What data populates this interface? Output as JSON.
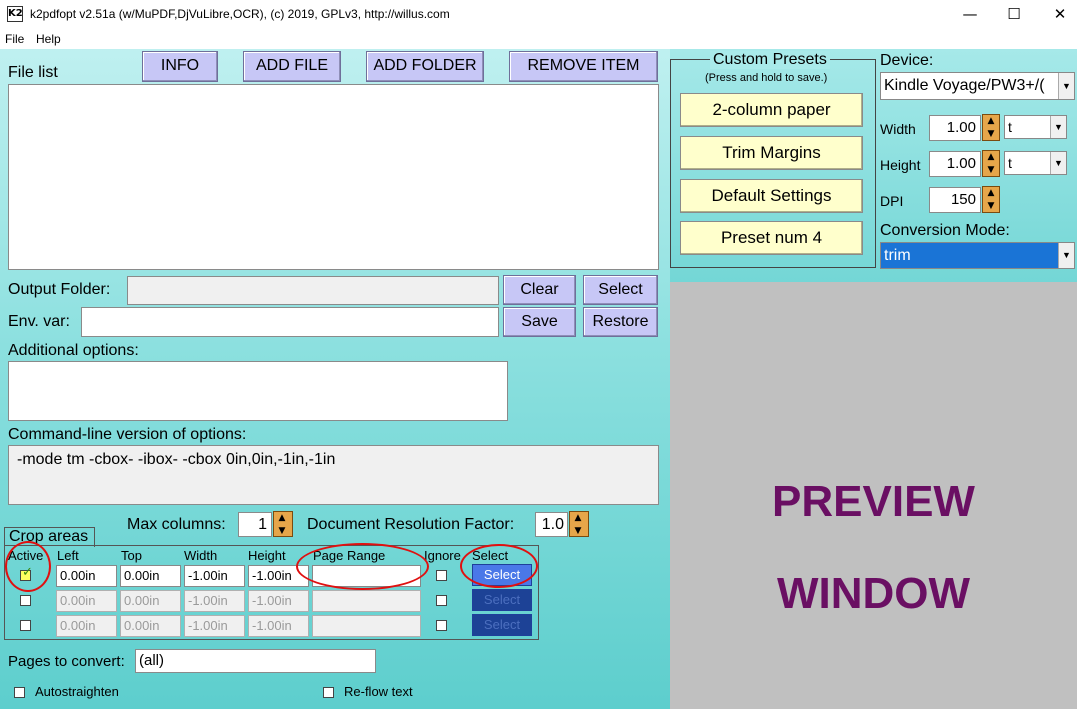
{
  "window": {
    "app_icon": "K2",
    "title": "k2pdfopt v2.51a (w/MuPDF,DjVuLibre,OCR), (c) 2019, GPLv3, http://willus.com",
    "minimize_icon": "—",
    "maximize_icon": "☐",
    "close_icon": "✕"
  },
  "menu": {
    "file": "File",
    "help": "Help"
  },
  "file_list": {
    "label": "File list",
    "info_button": "INFO",
    "add_file_button": "ADD FILE",
    "add_folder_button": "ADD FOLDER",
    "remove_item_button": "REMOVE ITEM"
  },
  "output": {
    "label": "Output Folder:",
    "value": "",
    "clear_button": "Clear",
    "select_button": "Select"
  },
  "env": {
    "label": "Env. var:",
    "value": "",
    "save_button": "Save",
    "restore_button": "Restore"
  },
  "additional": {
    "label": "Additional options:",
    "value": ""
  },
  "cmdline": {
    "label": "Command-line version of options:",
    "value": "-mode tm -cbox- -ibox- -cbox 0in,0in,-1in,-1in"
  },
  "max_columns": {
    "label": "Max columns:",
    "value": "1"
  },
  "doc_res": {
    "label": "Document Resolution Factor:",
    "value": "1.0"
  },
  "crop": {
    "title": "Crop areas",
    "headers": {
      "active": "Active",
      "left": "Left",
      "top": "Top",
      "width": "Width",
      "height": "Height",
      "page_range": "Page Range",
      "ignore": "Ignore",
      "select": "Select"
    },
    "rows": [
      {
        "active_mark": "✓",
        "left": "0.00in",
        "top": "0.00in",
        "width": "-1.00in",
        "height": "-1.00in",
        "page_range": "",
        "select": "Select"
      },
      {
        "active_mark": "",
        "left": "0.00in",
        "top": "0.00in",
        "width": "-1.00in",
        "height": "-1.00in",
        "page_range": "",
        "select": "Select"
      },
      {
        "active_mark": "",
        "left": "0.00in",
        "top": "0.00in",
        "width": "-1.00in",
        "height": "-1.00in",
        "page_range": "",
        "select": "Select"
      }
    ]
  },
  "pages": {
    "label": "Pages to convert:",
    "value": "(all)"
  },
  "options": {
    "autostraighten": "Autostraighten",
    "reflow": "Re-flow text"
  },
  "presets": {
    "title": "Custom Presets",
    "subtitle": "(Press and hold to save.)",
    "items": [
      "2-column paper",
      "Trim Margins",
      "Default Settings",
      "Preset num 4"
    ]
  },
  "device": {
    "label": "Device:",
    "value": "Kindle Voyage/PW3+/(",
    "width_label": "Width",
    "width_value": "1.00",
    "width_unit": "t",
    "height_label": "Height",
    "height_value": "1.00",
    "height_unit": "t",
    "dpi_label": "DPI",
    "dpi_value": "150"
  },
  "conversion": {
    "label": "Conversion Mode:",
    "value": "trim"
  },
  "preview": {
    "line1": "PREVIEW",
    "line2": "WINDOW"
  },
  "colors": {
    "accent_preview_text": "#6a0f63",
    "select_blue": "#4a78e8",
    "red_annotation": "#e01010"
  }
}
